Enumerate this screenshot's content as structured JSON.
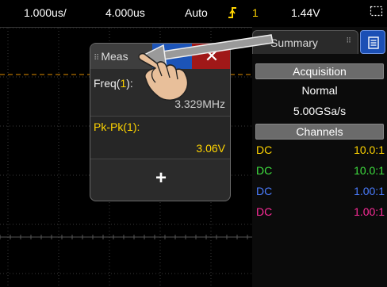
{
  "topbar": {
    "time_per_div": "1.000us/",
    "delay": "4.000us",
    "trigger_mode": "Auto",
    "trigger_icon": "trigger-edge-icon",
    "trigger_source": "1",
    "trigger_level": "1.44V",
    "selection_icon": "selection-box-icon"
  },
  "measurement_panel": {
    "title": "Meas",
    "close_label": "✕",
    "add_label": "+",
    "rows": [
      {
        "name": "Freq",
        "channel": "1",
        "value": "3.329MHz"
      },
      {
        "name": "Pk-Pk",
        "channel": "1",
        "value": "3.06V"
      }
    ]
  },
  "right_panel": {
    "tab_label": "Summary",
    "acquisition": {
      "header": "Acquisition",
      "mode": "Normal",
      "sample_rate": "5.00GSa/s"
    },
    "channels": {
      "header": "Channels",
      "rows": [
        {
          "coupling": "DC",
          "probe": "10.0:1",
          "color": "#ffd400"
        },
        {
          "coupling": "DC",
          "probe": "10.0:1",
          "color": "#3fe03f"
        },
        {
          "coupling": "DC",
          "probe": "1.00:1",
          "color": "#4a7cff"
        },
        {
          "coupling": "DC",
          "probe": "1.00:1",
          "color": "#ff2c9a"
        }
      ]
    }
  },
  "colors": {
    "trigger_level_line": "#e08c00",
    "channel1": "#ffd400",
    "close_button": "#a01818",
    "accent_blue": "#1c54b8"
  },
  "overlay": {
    "gesture_icon": "hand-pointer-icon",
    "arrow_icon": "drag-arrow-icon"
  }
}
